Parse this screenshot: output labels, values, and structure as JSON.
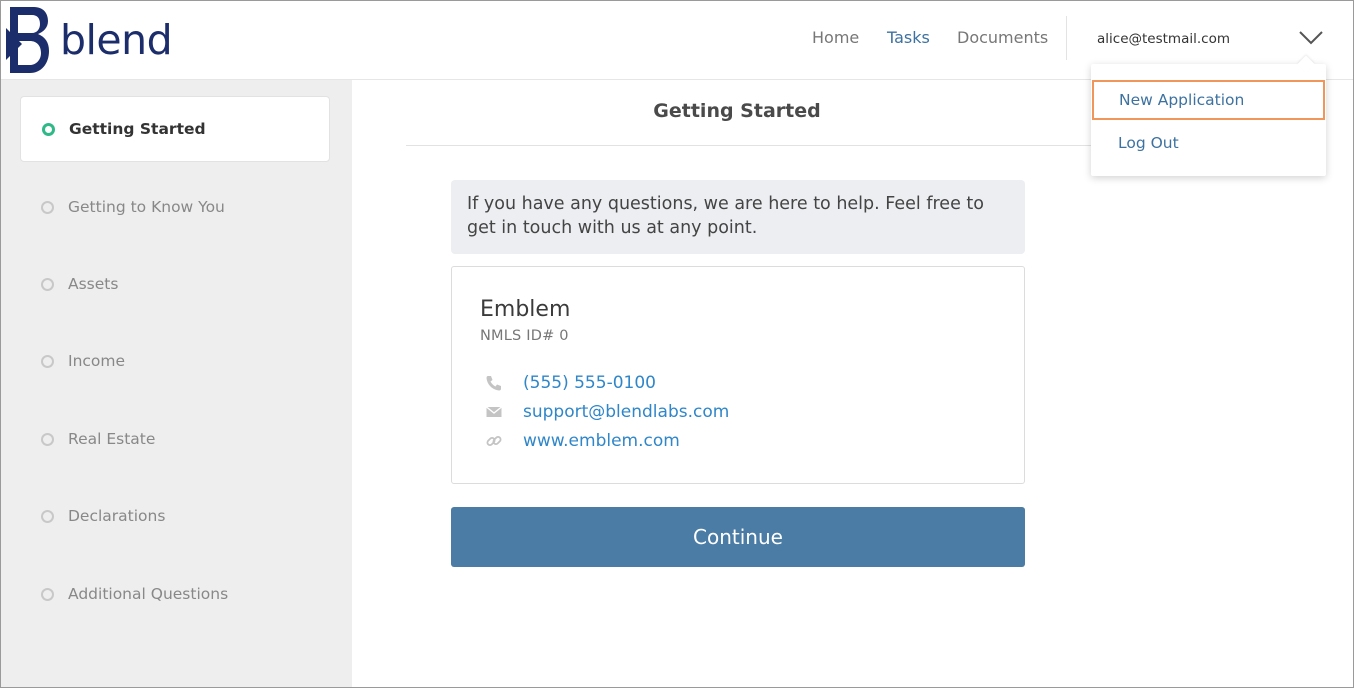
{
  "app": {
    "brand": "blend"
  },
  "header": {
    "nav": [
      {
        "label": "Home",
        "active": false
      },
      {
        "label": "Tasks",
        "active": true
      },
      {
        "label": "Documents",
        "active": false
      }
    ],
    "user_email": "alice@testmail.com",
    "menu_icon": "chevron-down-icon"
  },
  "user_menu": {
    "items": [
      {
        "label": "New Application",
        "highlighted": true
      },
      {
        "label": "Log Out",
        "highlighted": false
      }
    ]
  },
  "sidebar": {
    "items": [
      {
        "label": "Getting Started",
        "active": true
      },
      {
        "label": "Getting to Know You",
        "active": false
      },
      {
        "label": "Assets",
        "active": false
      },
      {
        "label": "Income",
        "active": false
      },
      {
        "label": "Real Estate",
        "active": false
      },
      {
        "label": "Declarations",
        "active": false
      },
      {
        "label": "Additional Questions",
        "active": false
      }
    ]
  },
  "main": {
    "title": "Getting Started",
    "help_text": "If you have any questions, we are here to help. Feel free to get in touch with us at any point.",
    "lender": {
      "name": "Emblem",
      "nmls": "NMLS ID# 0",
      "phone": "(555) 555-0100",
      "email": "support@blendlabs.com",
      "website": "www.emblem.com"
    },
    "continue_label": "Continue"
  },
  "colors": {
    "brand": "#1c2d6b",
    "link": "#2f86c9",
    "active_nav": "#3d72a0",
    "button": "#4a7ca5",
    "status_active": "#2fb888",
    "highlight": "#f0965a"
  }
}
